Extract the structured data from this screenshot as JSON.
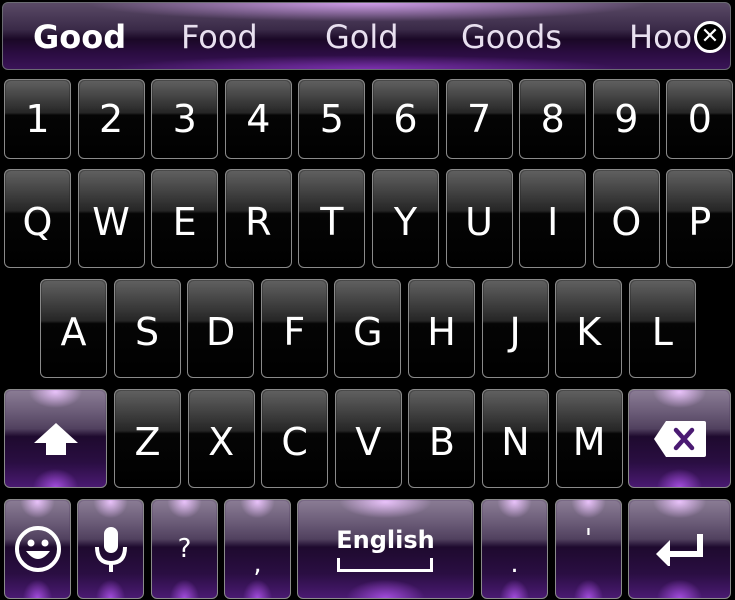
{
  "suggestions": {
    "items": [
      "Good",
      "Food",
      "Gold",
      "Goods",
      "Hoo"
    ],
    "close_icon": "close-circle-icon"
  },
  "rows": {
    "numbers": [
      "1",
      "2",
      "3",
      "4",
      "5",
      "6",
      "7",
      "8",
      "9",
      "0"
    ],
    "top": [
      "Q",
      "W",
      "E",
      "R",
      "T",
      "Y",
      "U",
      "I",
      "O",
      "P"
    ],
    "middle": [
      "A",
      "S",
      "D",
      "F",
      "G",
      "H",
      "J",
      "K",
      "L"
    ],
    "bottom": [
      "Z",
      "X",
      "C",
      "V",
      "B",
      "N",
      "M"
    ]
  },
  "special_keys": {
    "shift": "shift-arrow-icon",
    "backspace": "backspace-icon",
    "emoji": "emoji-icon",
    "mic": "microphone-icon",
    "question": "?",
    "comma": ",",
    "space_label": "English",
    "period": ".",
    "apostrophe": "'",
    "enter": "enter-icon"
  },
  "theme": {
    "accent": "#9a4fd8",
    "key_bg": "#000000",
    "text": "#ffffff"
  }
}
